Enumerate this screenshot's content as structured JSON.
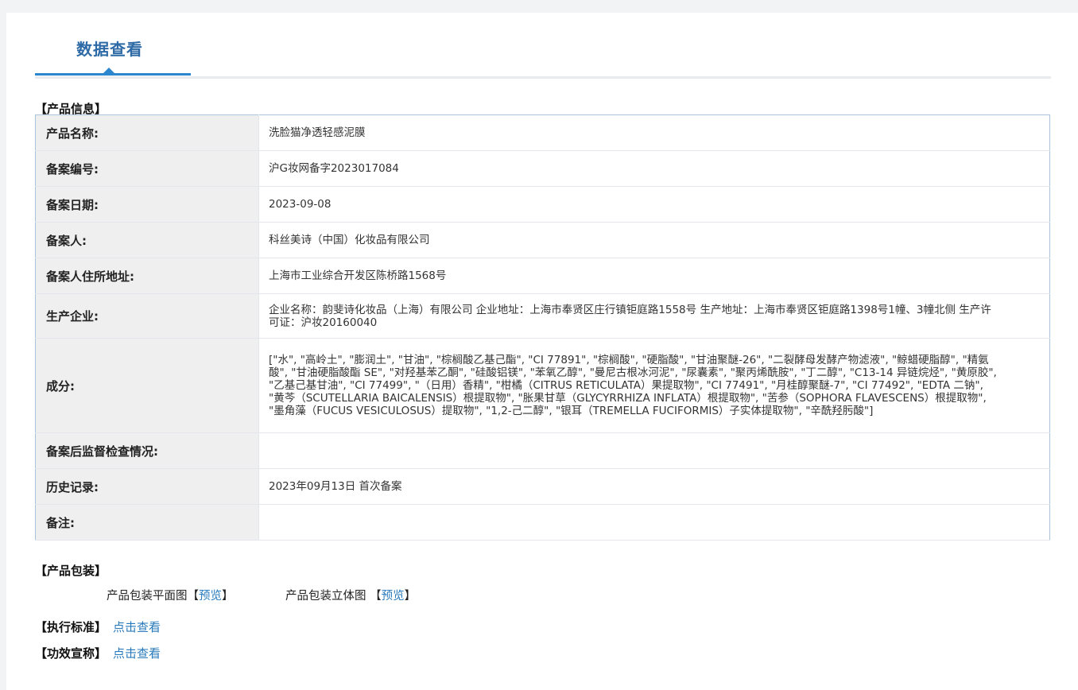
{
  "tab": {
    "title": "数据查看"
  },
  "product_info": {
    "heading": "【产品信息】",
    "rows": [
      {
        "label": "产品名称:",
        "value": "洗脸猫净透轻感泥膜"
      },
      {
        "label": "备案编号:",
        "value": "沪G妆网备字2023017084"
      },
      {
        "label": "备案日期:",
        "value": "2023-09-08"
      },
      {
        "label": "备案人:",
        "value": "科丝美诗（中国）化妆品有限公司"
      },
      {
        "label": "备案人住所地址:",
        "value": "上海市工业综合开发区陈桥路1568号"
      },
      {
        "label": "生产企业:",
        "value": "企业名称：韵斐诗化妆品（上海）有限公司 企业地址：上海市奉贤区庄行镇钜庭路1558号 生产地址：上海市奉贤区钜庭路1398号1幢、3幢北侧 生产许可证：沪妆20160040"
      },
      {
        "label": "成分:",
        "value": "[\"水\", \"高岭土\", \"膨润土\", \"甘油\", \"棕榈酸乙基己酯\", \"CI 77891\", \"棕榈酸\", \"硬脂酸\", \"甘油聚醚-26\", \"二裂酵母发酵产物滤液\", \"鲸蜡硬脂醇\", \"精氨酸\", \"甘油硬脂酸酯 SE\", \"对羟基苯乙酮\", \"硅酸铝镁\", \"苯氧乙醇\", \"曼尼古根冰河泥\", \"尿囊素\", \"聚丙烯酰胺\", \"丁二醇\", \"C13-14 异链烷烃\", \"黄原胶\", \"乙基己基甘油\", \"CI 77499\", \"（日用）香精\", \"柑橘（CITRUS RETICULATA）果提取物\", \"CI 77491\", \"月桂醇聚醚-7\", \"CI 77492\", \"EDTA 二钠\", \"黄芩（SCUTELLARIA BAICALENSIS）根提取物\", \"胀果甘草（GLYCYRRHIZA INFLATA）根提取物\", \"苦参（SOPHORA FLAVESCENS）根提取物\", \"墨角藻（FUCUS VESICULOSUS）提取物\", \"1,2-己二醇\", \"银耳（TREMELLA FUCIFORMIS）子实体提取物\", \"辛酰羟肟酸\"]"
      },
      {
        "label": "备案后监督检查情况:",
        "value": ""
      },
      {
        "label": "历史记录:",
        "value": "2023年09月13日 首次备案"
      },
      {
        "label": "备注:",
        "value": ""
      }
    ]
  },
  "packaging": {
    "heading": "【产品包装】",
    "flat_label": "产品包装平面图【",
    "flat_link": "预览",
    "flat_close": "】",
    "solid_label": "产品包装立体图 【",
    "solid_link": "预览",
    "solid_close": "】"
  },
  "standard": {
    "label": "【执行标准】",
    "link": "点击查看"
  },
  "efficacy": {
    "label": "【功效宣称】",
    "link": "点击查看"
  }
}
